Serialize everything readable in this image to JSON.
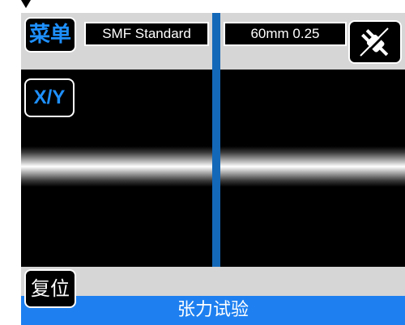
{
  "toolbar": {
    "menu_label": "菜单",
    "xy_label": "X/Y",
    "reset_label": "复位",
    "power_icon": "power-plug-icon"
  },
  "info": {
    "fiber_type": "SMF Standard",
    "cleave_setting": "60mm 0.25"
  },
  "status": {
    "text": "张力试验"
  },
  "colors": {
    "accent": "#1e90ff",
    "cursor_line": "#1468b8",
    "status_bar": "#1e80f0",
    "band": "#d6d6d6",
    "display_bg": "#000000"
  }
}
